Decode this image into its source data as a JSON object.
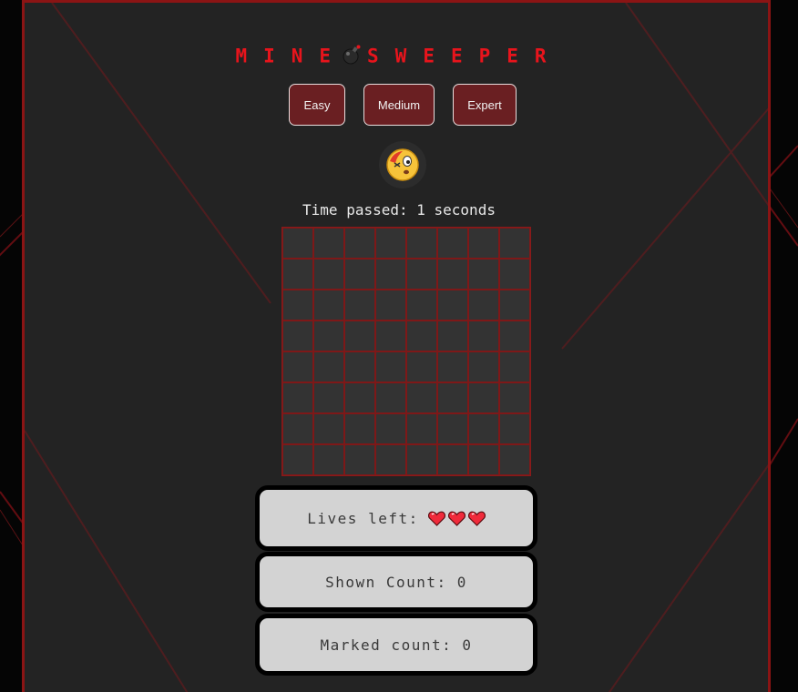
{
  "title": {
    "left": "MINE",
    "right": "SWEEPER",
    "icon": "bomb-icon"
  },
  "levels": [
    {
      "label": "Easy"
    },
    {
      "label": "Medium"
    },
    {
      "label": "Expert"
    }
  ],
  "face": {
    "icon": "dizzy-face-icon"
  },
  "timer": {
    "text": "Time passed: 1 seconds"
  },
  "board": {
    "rows": 8,
    "cols": 8,
    "state": "all-hidden"
  },
  "stats": {
    "lives_label": "Lives left:",
    "lives": 3,
    "lives_icon": "heart-icon",
    "shown_text": "Shown Count: 0",
    "marked_text": "Marked count: 0"
  },
  "colors": {
    "accent": "#e8141c",
    "panel_bg": "#232323",
    "button_bg": "#6a1f22",
    "cell_bg": "#333333",
    "cell_border": "#7e1818",
    "stat_bg": "#d3d3d3"
  }
}
